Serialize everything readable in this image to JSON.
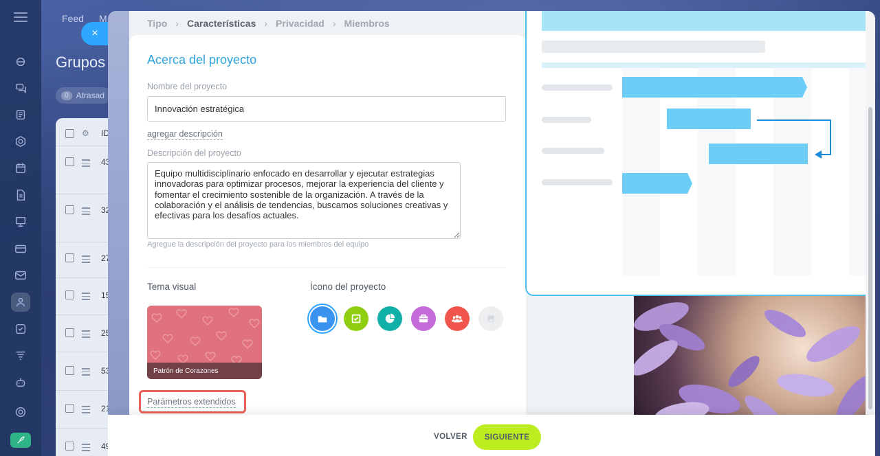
{
  "background": {
    "nav": [
      "Feed",
      "M"
    ],
    "title": "Grupos",
    "chip": {
      "count": "0",
      "label": "Atrasad"
    },
    "table_header_id": "ID",
    "row_ids": [
      "43",
      "32",
      "27",
      "15",
      "25",
      "53",
      "21",
      "49"
    ]
  },
  "slider": {
    "close_symbol": "×",
    "stepper": [
      "Tipo",
      "Características",
      "Privacidad",
      "Miembros"
    ],
    "section_title": "Acerca del proyecto",
    "name_label": "Nombre del proyecto",
    "name_value": "Innovación estratégica",
    "add_description": "agregar descripción",
    "description_label": "Descripción del proyecto",
    "description_value": "Equipo multidisciplinario enfocado en desarrollar y ejecutar estrategias innovadoras para optimizar procesos, mejorar la experiencia del cliente y fomentar el crecimiento sostenible de la organización. A través de la colaboración y el análisis de tendencias, buscamos soluciones creativas y efectivas para los desafíos actuales.",
    "description_hint": "Agregue la descripción del proyecto para los miembros del equipo",
    "theme_label": "Tema visual",
    "theme_name": "Patrón de Corazones",
    "icon_label": "Ícono del proyecto",
    "icons": [
      {
        "name": "folder-icon",
        "color": "#3b93f0"
      },
      {
        "name": "checklist-icon",
        "color": "#8fcd11"
      },
      {
        "name": "pie-chart-icon",
        "color": "#11b0a6"
      },
      {
        "name": "briefcase-icon",
        "color": "#c36bd8"
      },
      {
        "name": "team-icon",
        "color": "#f2554c"
      },
      {
        "name": "image-icon",
        "color": "#eceef0"
      }
    ],
    "extended_params": "Parámetros extendidos",
    "footer": {
      "back": "VOLVER",
      "next": "SIGUIENTE"
    }
  },
  "colors": {
    "accent": "#2fa3d9",
    "next_button": "#bbed21",
    "highlight": "#e8625a"
  }
}
